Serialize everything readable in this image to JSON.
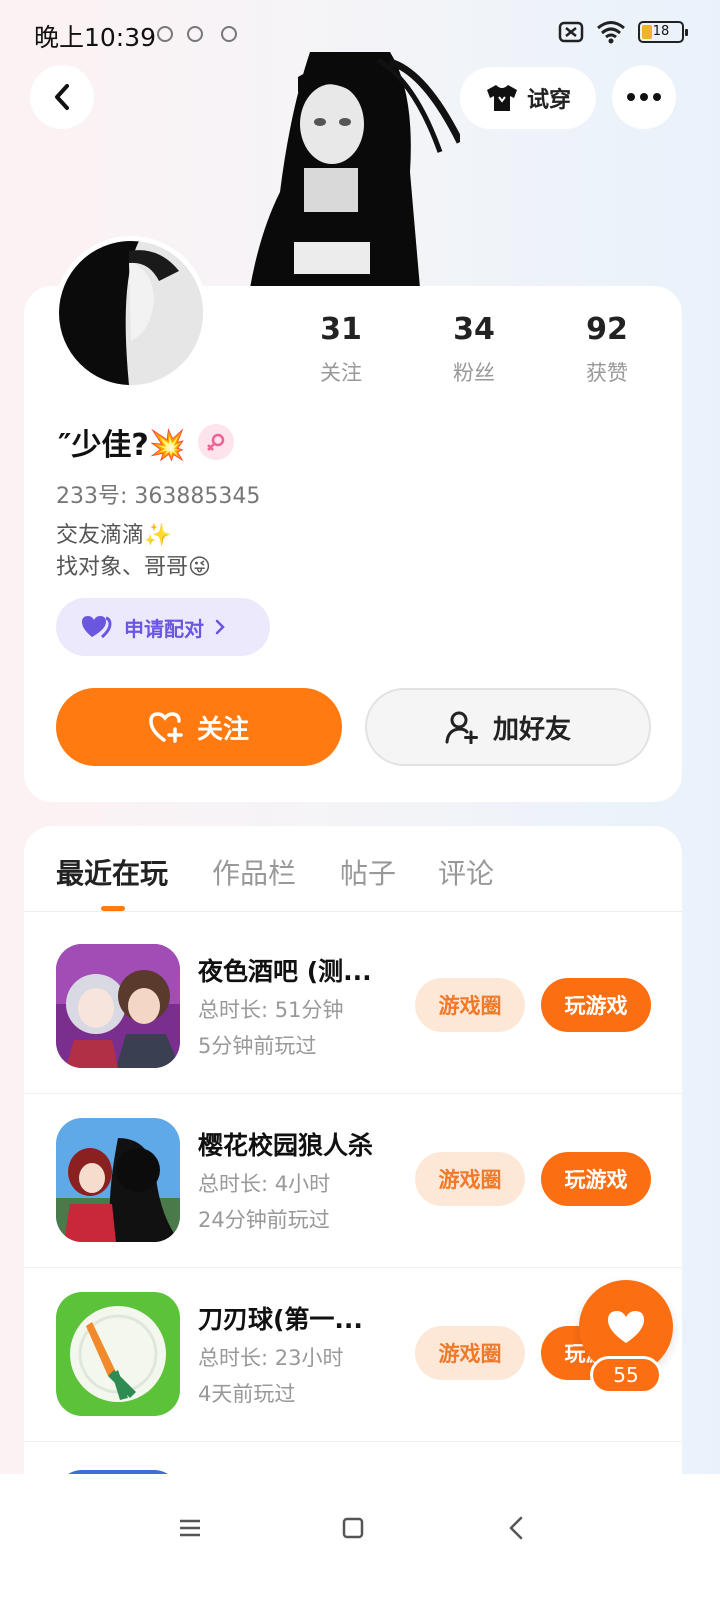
{
  "status_bar": {
    "time": "晚上10:39",
    "battery": "18"
  },
  "header": {
    "try_on_label": "试穿"
  },
  "stats": [
    {
      "num": "31",
      "label": "关注"
    },
    {
      "num": "34",
      "label": "粉丝"
    },
    {
      "num": "92",
      "label": "获赞"
    }
  ],
  "profile": {
    "nickname": "″少佳?💥",
    "id_text": "233号: 363885345",
    "bio_line1": "交友滴滴✨",
    "bio_line2": "找对象、哥哥😜",
    "pair_label": "申请配对",
    "follow_label": "关注",
    "add_friend_label": "加好友"
  },
  "tabs": [
    {
      "label": "最近在玩"
    },
    {
      "label": "作品栏"
    },
    {
      "label": "帖子"
    },
    {
      "label": "评论"
    }
  ],
  "games": [
    {
      "title": "夜色酒吧 (测...",
      "duration": "总时长: 51分钟",
      "last_played": "5分钟前玩过",
      "circle_label": "游戏圈",
      "play_label": "玩游戏"
    },
    {
      "title": "樱花校园狼人杀",
      "duration": "总时长: 4小时",
      "last_played": "24分钟前玩过",
      "circle_label": "游戏圈",
      "play_label": "玩游戏"
    },
    {
      "title": "刀刃球(第一...",
      "duration": "总时长: 23小时",
      "last_played": "4天前玩过",
      "circle_label": "游戏圈",
      "play_label": "玩游戏"
    }
  ],
  "float_like": {
    "count": "55"
  },
  "colors": {
    "accent": "#ff7a10",
    "pair_accent": "#6a57e0"
  },
  "icons": [
    "back-icon",
    "shirt-icon",
    "more-icon",
    "female-icon",
    "heart-pair-icon",
    "heart-plus-icon",
    "user-plus-icon",
    "heart-icon",
    "menu-icon",
    "home-icon",
    "back-nav-icon"
  ]
}
